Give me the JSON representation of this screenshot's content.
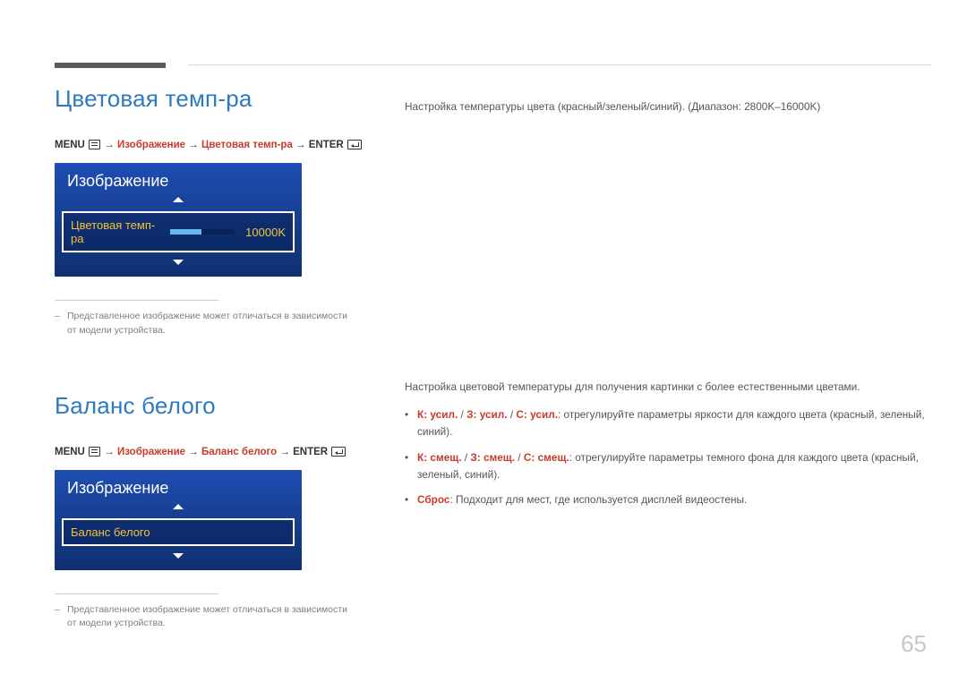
{
  "page_number": "65",
  "section1": {
    "title": "Цветовая темп-ра",
    "path_prefix": "MENU",
    "path_mid": "Изображение",
    "path_mid2": "Цветовая темп-ра",
    "path_suffix": "ENTER",
    "arrow": "→",
    "osd_title": "Изображение",
    "osd_row_label": "Цветовая темп-ра",
    "osd_row_value": "10000K",
    "note": "Представленное изображение может отличаться в зависимости от модели устройства.",
    "right_text": "Настройка температуры цвета (красный/зеленый/синий). (Диапазон: 2800K–16000K)"
  },
  "section2": {
    "title": "Баланс белого",
    "path_prefix": "MENU",
    "path_mid": "Изображение",
    "path_mid2": "Баланс белого",
    "path_suffix": "ENTER",
    "arrow": "→",
    "osd_title": "Изображение",
    "osd_row_label": "Баланс белого",
    "note": "Представленное изображение может отличаться в зависимости от модели устройства.",
    "right_intro": "Настройка цветовой температуры для получения картинки с более естественными цветами.",
    "bullets": [
      {
        "hl1": "К: усил.",
        "sep1": " / ",
        "hl2": "З: усил.",
        "sep2": " / ",
        "hl3": "С: усил.",
        "rest": ": отрегулируйте параметры яркости для каждого цвета (красный, зеленый, синий)."
      },
      {
        "hl1": "К: смещ.",
        "sep1": " / ",
        "hl2": "З: смещ.",
        "sep2": " / ",
        "hl3": "С: смещ.",
        "rest": ": отрегулируйте параметры темного фона для каждого цвета (красный, зеленый, синий)."
      },
      {
        "hl1": "Сброс",
        "rest": ": Подходит для мест, где используется дисплей видеостены."
      }
    ]
  }
}
